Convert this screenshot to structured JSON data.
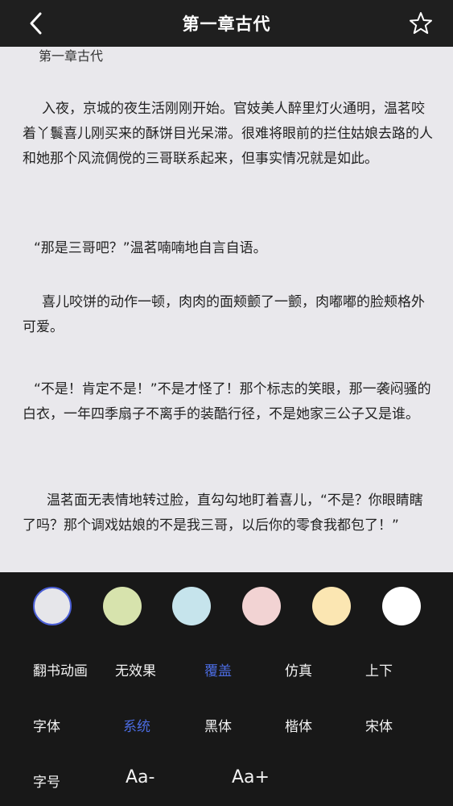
{
  "header": {
    "title": "第一章古代",
    "back_icon": "chevron-left-icon",
    "favorite_icon": "star-outline-icon"
  },
  "content": {
    "chapter_heading": "第一章古代",
    "paragraphs": [
      "入夜，京城的夜生活刚刚开始。官妓美人醉里灯火通明，温茗咬着丫鬟喜儿刚买来的酥饼目光呆滞。很难将眼前的拦住姑娘去路的人和她那个风流倜傥的三哥联系起来，但事实情况就是如此。",
      "“那是三哥吧？”温茗喃喃地自言自语。",
      "喜儿咬饼的动作一顿，肉肉的面颊颤了一颤，肉嘟嘟的脸颊格外可爱。",
      "“不是！肯定不是！”不是才怪了！那个标志的笑眼，那一袭闷骚的白衣，一年四季扇子不离手的装酷行径，不是她家三公子又是谁。",
      "温茗面无表情地转过脸，直勾勾地盯着喜儿，“不是？你眼睛瞎了吗？那个调戏姑娘的不是我三哥，以后你的零食我都包了！”"
    ]
  },
  "settings": {
    "background_colors": [
      {
        "name": "gray",
        "color": "#e6e6ea",
        "selected": true
      },
      {
        "name": "green",
        "color": "#d7e3ad"
      },
      {
        "name": "blue",
        "color": "#c6e4ec"
      },
      {
        "name": "pink",
        "color": "#f2d3d3"
      },
      {
        "name": "yellow",
        "color": "#fbe6b2"
      },
      {
        "name": "white",
        "color": "#ffffff"
      }
    ],
    "animation": {
      "label": "翻书动画",
      "options": [
        "无效果",
        "覆盖",
        "仿真",
        "上下"
      ],
      "selected": "覆盖"
    },
    "font": {
      "label": "字体",
      "options": [
        "系统",
        "黑体",
        "楷体",
        "宋体"
      ],
      "selected": "系统"
    },
    "font_size": {
      "label": "字号",
      "decrease": "Aa-",
      "increase": "Aa+"
    },
    "accent_color": "#4b6be0"
  }
}
